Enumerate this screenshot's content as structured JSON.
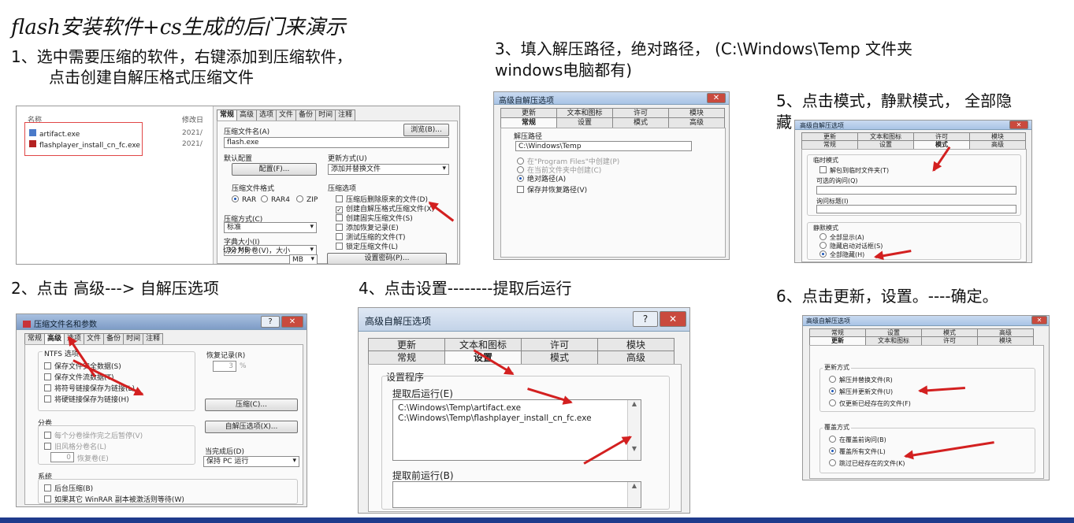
{
  "heading": "flash安装软件+cs生成的后门来演示",
  "steps": {
    "s1_line1": "1、选中需要压缩的软件，右键添加到压缩软件，",
    "s1_line2": "点击创建自解压格式压缩文件",
    "s2": "2、点击 高级---> 自解压选项",
    "s3_line1": "3、填入解压路径，绝对路径，  (C:\\Windows\\Temp 文件夹",
    "s3_line2": "windows电脑都有)",
    "s4": "4、点击设置--------提取后运行",
    "s5_line1": "5、点击模式，静默模式，  全部隐",
    "s5_line2": "藏",
    "s6": "6、点击更新，设置。----确定。"
  },
  "shot1": {
    "col_name": "名称",
    "col_modified": "修改日",
    "files": [
      {
        "name": "artifact.exe",
        "date": "2021/"
      },
      {
        "name": "flashplayer_install_cn_fc.exe",
        "date": "2021/"
      }
    ],
    "tabs": [
      "常规",
      "高级",
      "选项",
      "文件",
      "备份",
      "时间",
      "注释"
    ],
    "archive_name_label": "压缩文件名(A)",
    "archive_name_value": "flash.exe",
    "browse_button": "浏览(B)...",
    "default_profile_label": "默认配置",
    "profile_button": "配置(F)...",
    "update_mode_label": "更新方式(U)",
    "update_mode_value": "添加并替换文件",
    "format_label": "压缩文件格式",
    "formats": [
      "RAR",
      "RAR4",
      "ZIP"
    ],
    "options_label": "压缩选项",
    "options": [
      {
        "label": "压缩后删除原来的文件(D)",
        "checked": false
      },
      {
        "label": "创建自解压格式压缩文件(X)",
        "checked": true
      },
      {
        "label": "创建固实压缩文件(S)",
        "checked": false
      },
      {
        "label": "添加恢复记录(E)",
        "checked": false
      },
      {
        "label": "测试压缩的文件(T)",
        "checked": false
      },
      {
        "label": "锁定压缩文件(L)",
        "checked": false
      }
    ],
    "method_label": "压缩方式(C)",
    "method_value": "标准",
    "dict_label": "字典大小(I)",
    "dict_value": "32 MB",
    "split_label": "切分为分卷(V)，大小",
    "split_unit": "MB",
    "password_button": "设置密码(P)..."
  },
  "shot2": {
    "title": "压缩文件名和参数",
    "tabs": [
      "常规",
      "高级",
      "选项",
      "文件",
      "备份",
      "时间",
      "注释"
    ],
    "ntfs_label": "NTFS 选项",
    "ntfs": [
      "保存文件安全数据(S)",
      "保存文件流数据(T)",
      "将符号链接保存为链接(L)",
      "将硬链接保存为链接(H)"
    ],
    "recovery_label": "恢复记录(R)",
    "recovery_value": "3",
    "recovery_unit": "%",
    "compress_button": "压缩(C)...",
    "sfx_button": "自解压选项(X)...",
    "volumes_label": "分卷",
    "volumes": [
      "每个分卷操作完之后暂停(V)",
      "旧风格分卷名(L)"
    ],
    "recovery_volumes_value": "0",
    "recovery_volumes_label": "恢复卷(E)",
    "when_done_label": "当完成后(D)",
    "when_done_value": "保持 PC 运行",
    "system_label": "系统",
    "system": [
      "后台压缩(B)",
      "如果其它 WinRAR 副本被激活则等待(W)"
    ]
  },
  "shot3": {
    "title": "高级自解压选项",
    "tabs_top": [
      "更新",
      "文本和图标",
      "许可",
      "模块"
    ],
    "tabs_bottom": [
      "常规",
      "设置",
      "模式",
      "高级"
    ],
    "path_label": "解压路径",
    "path_value": "C:\\Windows\\Temp",
    "options": [
      {
        "label": "在\"Program Files\"中创建(P)",
        "on": false,
        "disabled": true
      },
      {
        "label": "在当前文件夹中创建(C)",
        "on": false,
        "disabled": true
      },
      {
        "label": "绝对路径(A)",
        "on": true,
        "disabled": false
      }
    ],
    "save_restore": "保存并恢复路径(V)"
  },
  "shot4": {
    "title": "高级自解压选项",
    "tabs_top": [
      "更新",
      "文本和图标",
      "许可",
      "模块"
    ],
    "tabs_bottom": [
      "常规",
      "设置",
      "模式",
      "高级"
    ],
    "setup_label": "设置程序",
    "run_after_label": "提取后运行(E)",
    "run_after_lines": [
      "C:\\Windows\\Temp\\artifact.exe",
      "C:\\Windows\\Temp\\flashplayer_install_cn_fc.exe"
    ],
    "run_before_label": "提取前运行(B)"
  },
  "shot5": {
    "title": "高级自解压选项",
    "tabs_top": [
      "更新",
      "文本和图标",
      "许可",
      "模块"
    ],
    "tabs_bottom": [
      "常规",
      "设置",
      "模式",
      "高级"
    ],
    "temp_label": "临时模式",
    "temp_check": "解包到临时文件夹(T)",
    "ask_label": "可选的询问(Q)",
    "ask_title_label": "询问标题(I)",
    "silent_label": "静默模式",
    "silent": [
      {
        "label": "全部显示(A)",
        "on": false
      },
      {
        "label": "隐藏启动对话框(S)",
        "on": false
      },
      {
        "label": "全部隐藏(H)",
        "on": true
      }
    ]
  },
  "shot6": {
    "title": "高级自解压选项",
    "tabs_top": [
      "常规",
      "设置",
      "模式",
      "高级"
    ],
    "tabs_bottom": [
      "更新",
      "文本和图标",
      "许可",
      "模块"
    ],
    "update_label": "更新方式",
    "update": [
      {
        "label": "解压并替换文件(R)",
        "on": false
      },
      {
        "label": "解压并更新文件(U)",
        "on": true
      },
      {
        "label": "仅更新已经存在的文件(F)",
        "on": false
      }
    ],
    "overwrite_label": "覆盖方式",
    "overwrite": [
      {
        "label": "在覆盖前询问(B)",
        "on": false
      },
      {
        "label": "覆盖所有文件(L)",
        "on": true
      },
      {
        "label": "跳过已经存在的文件(K)",
        "on": false
      }
    ]
  },
  "colors": {
    "arrow": "#d32020",
    "bottom_bar": "#1f3b8c",
    "title_bar": "#b9cfea"
  }
}
